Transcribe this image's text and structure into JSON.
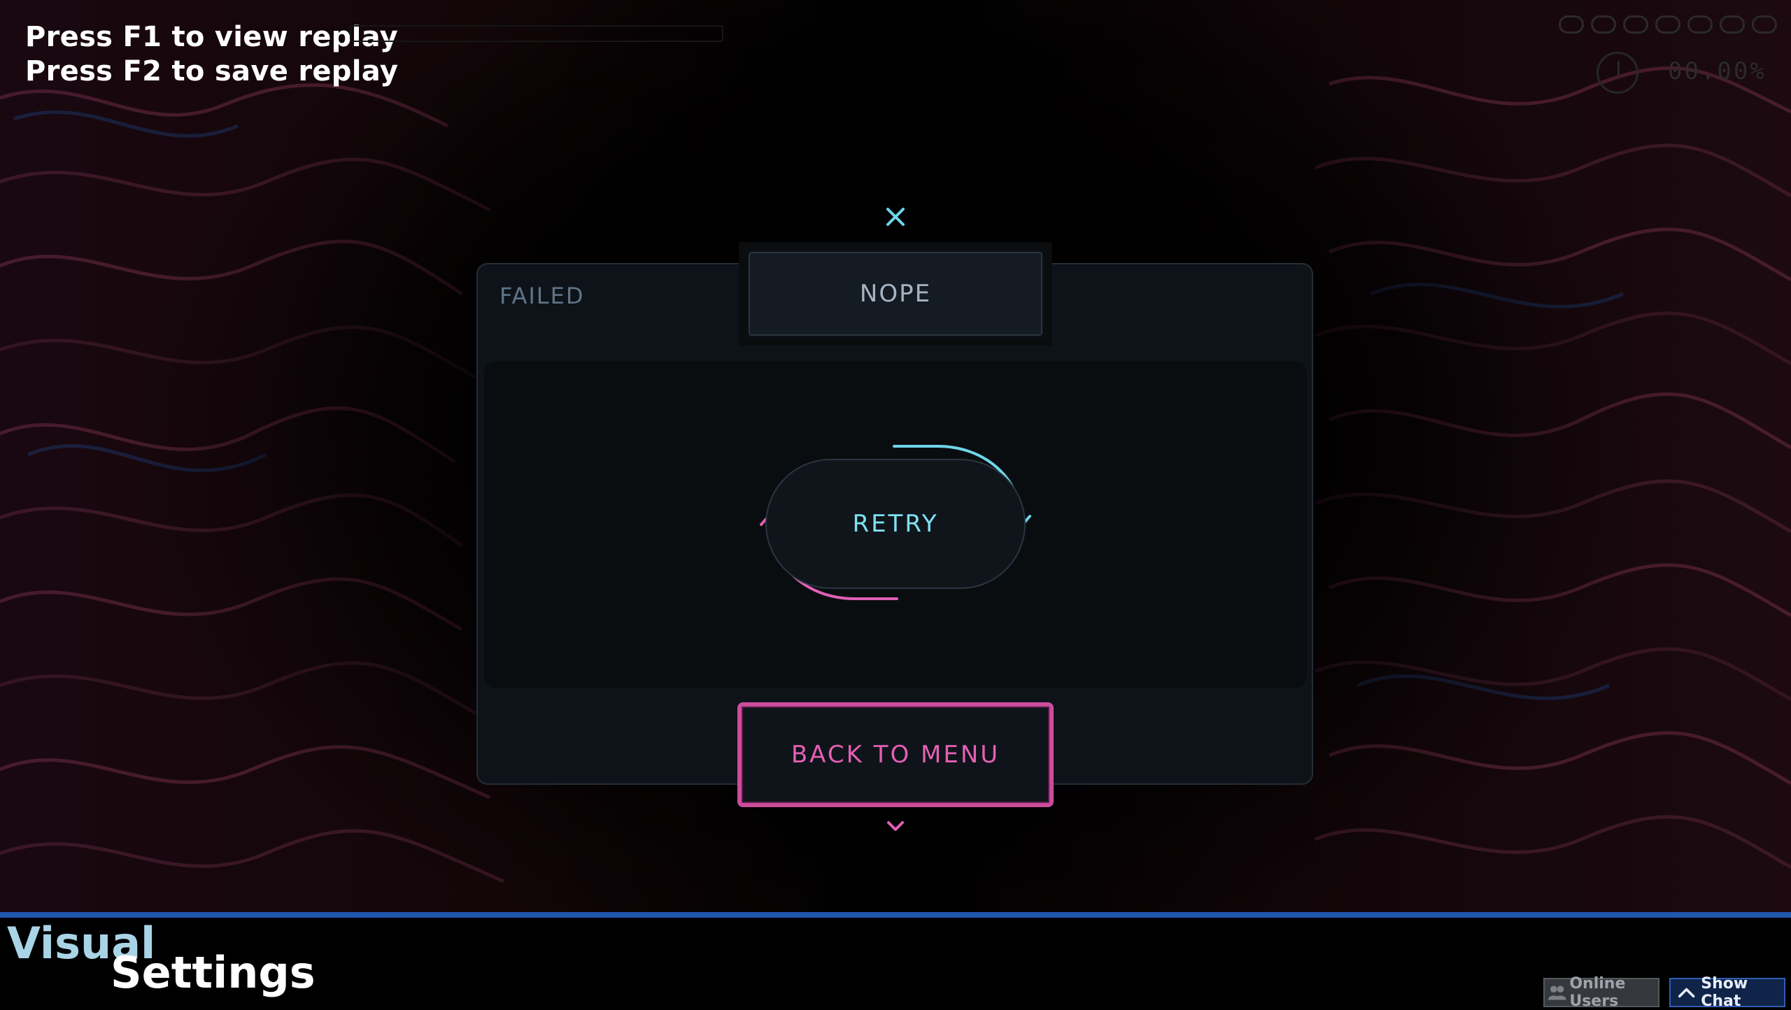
{
  "hints": {
    "line1": "Press F1 to view replay",
    "line2": "Press F2 to save replay"
  },
  "hud": {
    "percent": "00.00%"
  },
  "panel": {
    "title": "FAILED",
    "close_icon": "close-icon",
    "nope_label": "NOPE",
    "retry_label": "RETRY",
    "back_label": "BACK TO MENU",
    "down_icon": "chevron-down-icon"
  },
  "footer": {
    "brand_top": "Visual",
    "brand_bottom": "Settings",
    "online_users": "Online Users",
    "show_chat": "Show Chat"
  },
  "colors": {
    "accent_cyan": "#7ee0f0",
    "accent_pink": "#e460b4",
    "bottom_bar": "#1f57b0"
  }
}
